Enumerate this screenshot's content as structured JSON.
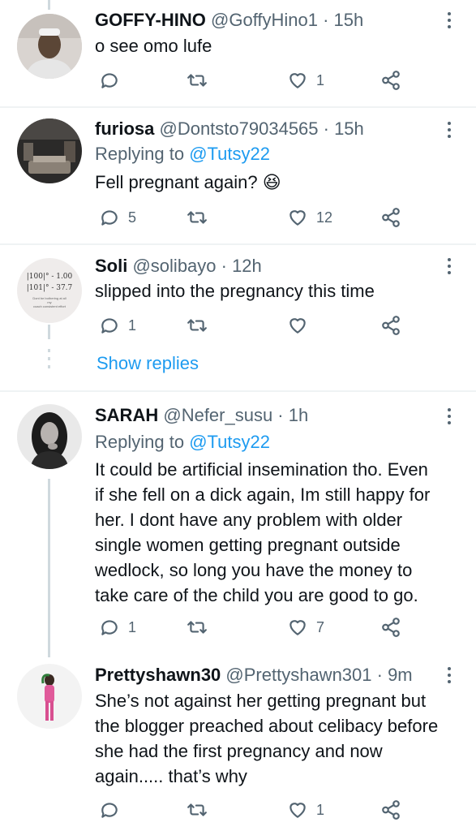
{
  "tweets": [
    {
      "name": "GOFFY-HINO",
      "handle": "@GoffyHino1 · 15h",
      "text": "o see omo lufe",
      "replies": "",
      "likes": "1"
    },
    {
      "name": "furiosa",
      "handle": "@Dontsto79034565 · 15h",
      "replying_prefix": "Replying to ",
      "replying_to": "@Tutsy22",
      "text": "Fell pregnant again? 😆",
      "replies": "5",
      "likes": "12"
    },
    {
      "name": "Soli",
      "handle": "@solibayo · 12h",
      "text": "slipped into the pregnancy this time",
      "replies": "1",
      "likes": "",
      "avatar_lines": [
        "|100|° - 1.00",
        "|101|° - 37.7",
        "Dont be bothering at all",
        "my",
        "coach consistent effort"
      ]
    },
    {
      "name": "SARAH",
      "handle": "@Nefer_susu · 1h",
      "replying_prefix": "Replying to ",
      "replying_to": "@Tutsy22",
      "text_lines": [
        "It could be artificial insemination tho. Even",
        "if she fell on a dick again, Im still happy for",
        "her. I dont have any problem with older",
        "single women getting pregnant outside",
        "wedlock, so long you have the money to",
        "take care of the child you are good to go."
      ],
      "replies": "1",
      "likes": "7"
    },
    {
      "name": "Prettyshawn30",
      "handle": "@Prettyshawn301 · 9m",
      "text_lines": [
        "She’s not against her getting pregnant but",
        "the blogger preached about celibacy before",
        "she had the first pregnancy and now",
        "again..... that’s why"
      ],
      "replies": "",
      "likes": "1"
    }
  ],
  "show_replies": "Show replies",
  "icons": {
    "reply": "reply-icon",
    "retweet": "retweet-icon",
    "like": "heart-icon",
    "share": "share-icon",
    "more": "more-icon"
  },
  "colors": {
    "link": "#1d9bf0",
    "secondary_text": "#536471",
    "primary_text": "#0f1419",
    "divider": "#eff3f4"
  }
}
